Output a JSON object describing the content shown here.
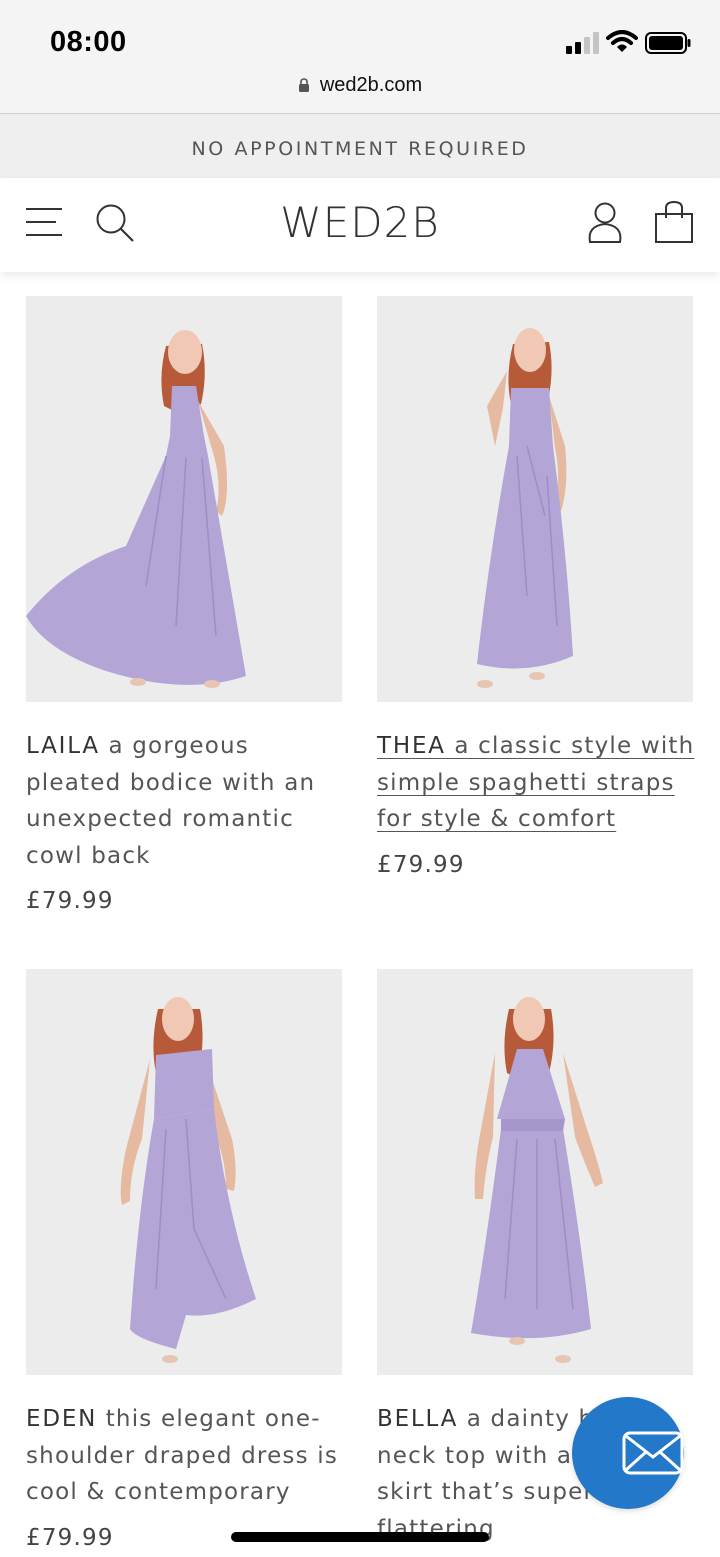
{
  "status_bar": {
    "time": "08:00"
  },
  "browser": {
    "url": "wed2b.com"
  },
  "promo": {
    "text": "NO APPOINTMENT REQUIRED"
  },
  "header": {
    "logo": "WED2B",
    "icons": [
      "menu-icon",
      "search-icon",
      "account-icon",
      "bag-icon"
    ]
  },
  "products": [
    {
      "name": "LAILA",
      "description": " a gorgeous pleated bodice with an unexpected romantic cowl back",
      "price": "£79.99",
      "underlined": false
    },
    {
      "name": "THEA",
      "description": " a classic style with simple spaghetti straps for style & comfort",
      "price": "£79.99",
      "underlined": true
    },
    {
      "name": "EDEN",
      "description": " this elegant one-shoulder draped dress is cool & contemporary",
      "price": "£79.99",
      "underlined": false
    },
    {
      "name": "BELLA",
      "description": " a dainty halter neck top with a stylish skirt that’s super flattering",
      "price": "",
      "underlined": false
    }
  ],
  "colors": {
    "dress": "#b3a5d6",
    "image_bg": "#ececec",
    "chat_button": "#2378c9",
    "status_bg": "#f4f4f4",
    "promo_bg": "#efefef"
  },
  "chat": {
    "icon": "mail-icon"
  }
}
